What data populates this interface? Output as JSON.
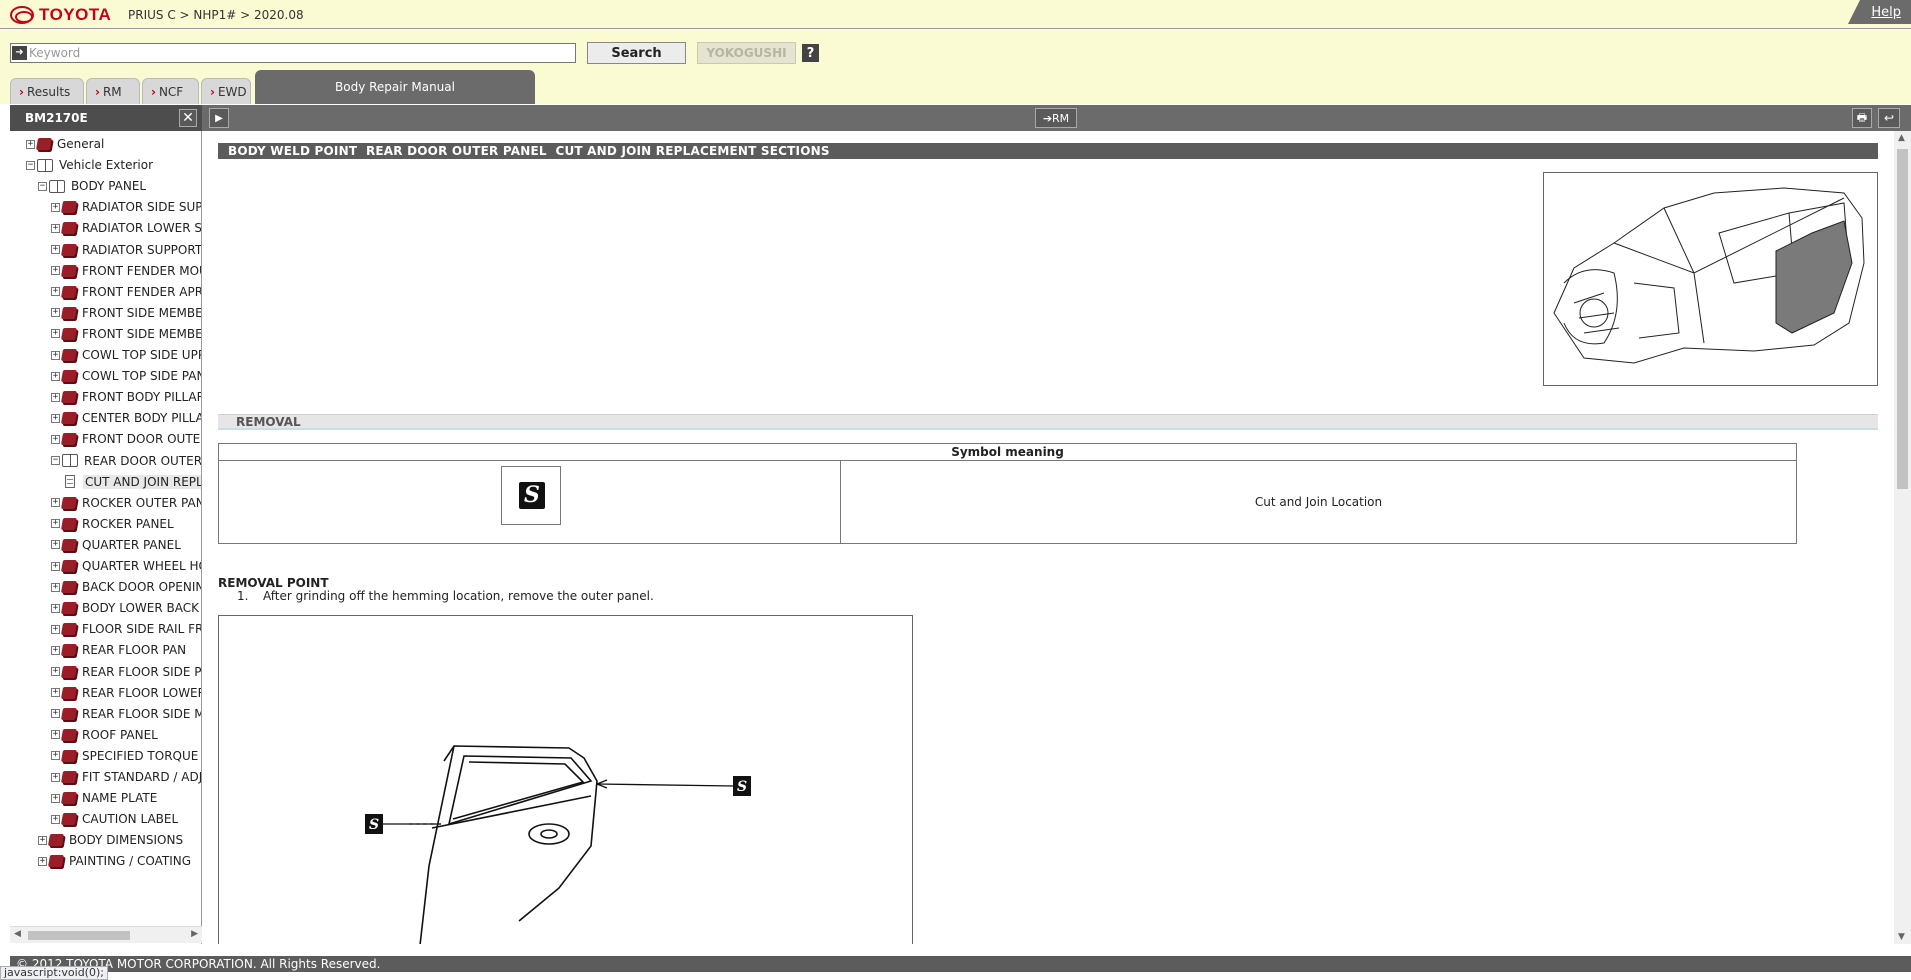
{
  "header": {
    "brand": "TOYOTA",
    "breadcrumb": "PRIUS C > NHP1# > 2020.08",
    "help": "Help"
  },
  "search": {
    "placeholder": "Keyword",
    "value": "",
    "search_label": "Search",
    "yokogushi_label": "YOKOGUSHI",
    "help_label": "?"
  },
  "tabs": [
    {
      "label": "Results"
    },
    {
      "label": "RM"
    },
    {
      "label": "NCF"
    },
    {
      "label": "EWD"
    }
  ],
  "active_tab": "Body Repair Manual",
  "left_panel": {
    "code": "BM2170E",
    "close": "✕"
  },
  "toolbar": {
    "play": "▶",
    "rm_link": "➔RM",
    "print": "🖶",
    "back": "↩"
  },
  "tree": [
    {
      "label": "General",
      "level": 1,
      "state": "+",
      "icon": "book"
    },
    {
      "label": "Vehicle Exterior",
      "level": 1,
      "state": "-",
      "icon": "book-open"
    },
    {
      "label": "BODY PANEL",
      "level": 2,
      "state": "-",
      "icon": "book-open"
    },
    {
      "label": "RADIATOR SIDE SUP",
      "level": 3,
      "state": "+",
      "icon": "book"
    },
    {
      "label": "RADIATOR LOWER SU",
      "level": 3,
      "state": "+",
      "icon": "book"
    },
    {
      "label": "RADIATOR SUPPORT",
      "level": 3,
      "state": "+",
      "icon": "book"
    },
    {
      "label": "FRONT FENDER MOU",
      "level": 3,
      "state": "+",
      "icon": "book"
    },
    {
      "label": "FRONT FENDER APRO",
      "level": 3,
      "state": "+",
      "icon": "book"
    },
    {
      "label": "FRONT SIDE MEMBER",
      "level": 3,
      "state": "+",
      "icon": "book"
    },
    {
      "label": "FRONT SIDE MEMBER",
      "level": 3,
      "state": "+",
      "icon": "book"
    },
    {
      "label": "COWL TOP SIDE UPP",
      "level": 3,
      "state": "+",
      "icon": "book"
    },
    {
      "label": "COWL TOP SIDE PAN",
      "level": 3,
      "state": "+",
      "icon": "book"
    },
    {
      "label": "FRONT BODY PILLAR",
      "level": 3,
      "state": "+",
      "icon": "book"
    },
    {
      "label": "CENTER BODY PILLA",
      "level": 3,
      "state": "+",
      "icon": "book"
    },
    {
      "label": "FRONT DOOR OUTER",
      "level": 3,
      "state": "+",
      "icon": "book"
    },
    {
      "label": "REAR DOOR OUTER F",
      "level": 3,
      "state": "-",
      "icon": "book-open"
    },
    {
      "label": "CUT AND JOIN REPLA",
      "level": 4,
      "state": "",
      "icon": "doc",
      "selected": true
    },
    {
      "label": "ROCKER OUTER PANI",
      "level": 3,
      "state": "+",
      "icon": "book"
    },
    {
      "label": "ROCKER PANEL",
      "level": 3,
      "state": "+",
      "icon": "book"
    },
    {
      "label": "QUARTER PANEL",
      "level": 3,
      "state": "+",
      "icon": "book"
    },
    {
      "label": "QUARTER WHEEL HO",
      "level": 3,
      "state": "+",
      "icon": "book"
    },
    {
      "label": "BACK DOOR OPENIN",
      "level": 3,
      "state": "+",
      "icon": "book"
    },
    {
      "label": "BODY LOWER BACK F",
      "level": 3,
      "state": "+",
      "icon": "book"
    },
    {
      "label": "FLOOR SIDE RAIL FR",
      "level": 3,
      "state": "+",
      "icon": "book"
    },
    {
      "label": "REAR FLOOR PAN",
      "level": 3,
      "state": "+",
      "icon": "book"
    },
    {
      "label": "REAR FLOOR SIDE PA",
      "level": 3,
      "state": "+",
      "icon": "book"
    },
    {
      "label": "REAR FLOOR LOWER",
      "level": 3,
      "state": "+",
      "icon": "book"
    },
    {
      "label": "REAR FLOOR SIDE M",
      "level": 3,
      "state": "+",
      "icon": "book"
    },
    {
      "label": "ROOF PANEL",
      "level": 3,
      "state": "+",
      "icon": "book"
    },
    {
      "label": "SPECIFIED TORQUE",
      "level": 3,
      "state": "+",
      "icon": "book"
    },
    {
      "label": "FIT STANDARD / ADJ",
      "level": 3,
      "state": "+",
      "icon": "book"
    },
    {
      "label": "NAME PLATE",
      "level": 3,
      "state": "+",
      "icon": "book"
    },
    {
      "label": "CAUTION LABEL",
      "level": 3,
      "state": "+",
      "icon": "book"
    },
    {
      "label": "BODY DIMENSIONS",
      "level": 2,
      "state": "+",
      "icon": "book"
    },
    {
      "label": "PAINTING / COATING",
      "level": 2,
      "state": "+",
      "icon": "book"
    }
  ],
  "content": {
    "section_title": "BODY WELD POINT  REAR DOOR OUTER PANEL  CUT AND JOIN REPLACEMENT SECTIONS",
    "removal_heading": "REMOVAL",
    "symbol_table": {
      "header": "Symbol meaning",
      "symbol": "S",
      "meaning": "Cut and Join Location"
    },
    "removal_point_title": "REMOVAL POINT",
    "steps": [
      {
        "num": "1.",
        "text": "After grinding off the hemming location, remove the outer panel."
      }
    ],
    "diagram_symbol": "S"
  },
  "footer": {
    "copyright": "© 2012 TOYOTA MOTOR CORPORATION. All Rights Reserved.",
    "status": "javascript:void(0);"
  },
  "colors": {
    "header_bg": "#fbfbd3",
    "brand_red": "#c4001a",
    "bar_gray": "#6b6b6b"
  }
}
